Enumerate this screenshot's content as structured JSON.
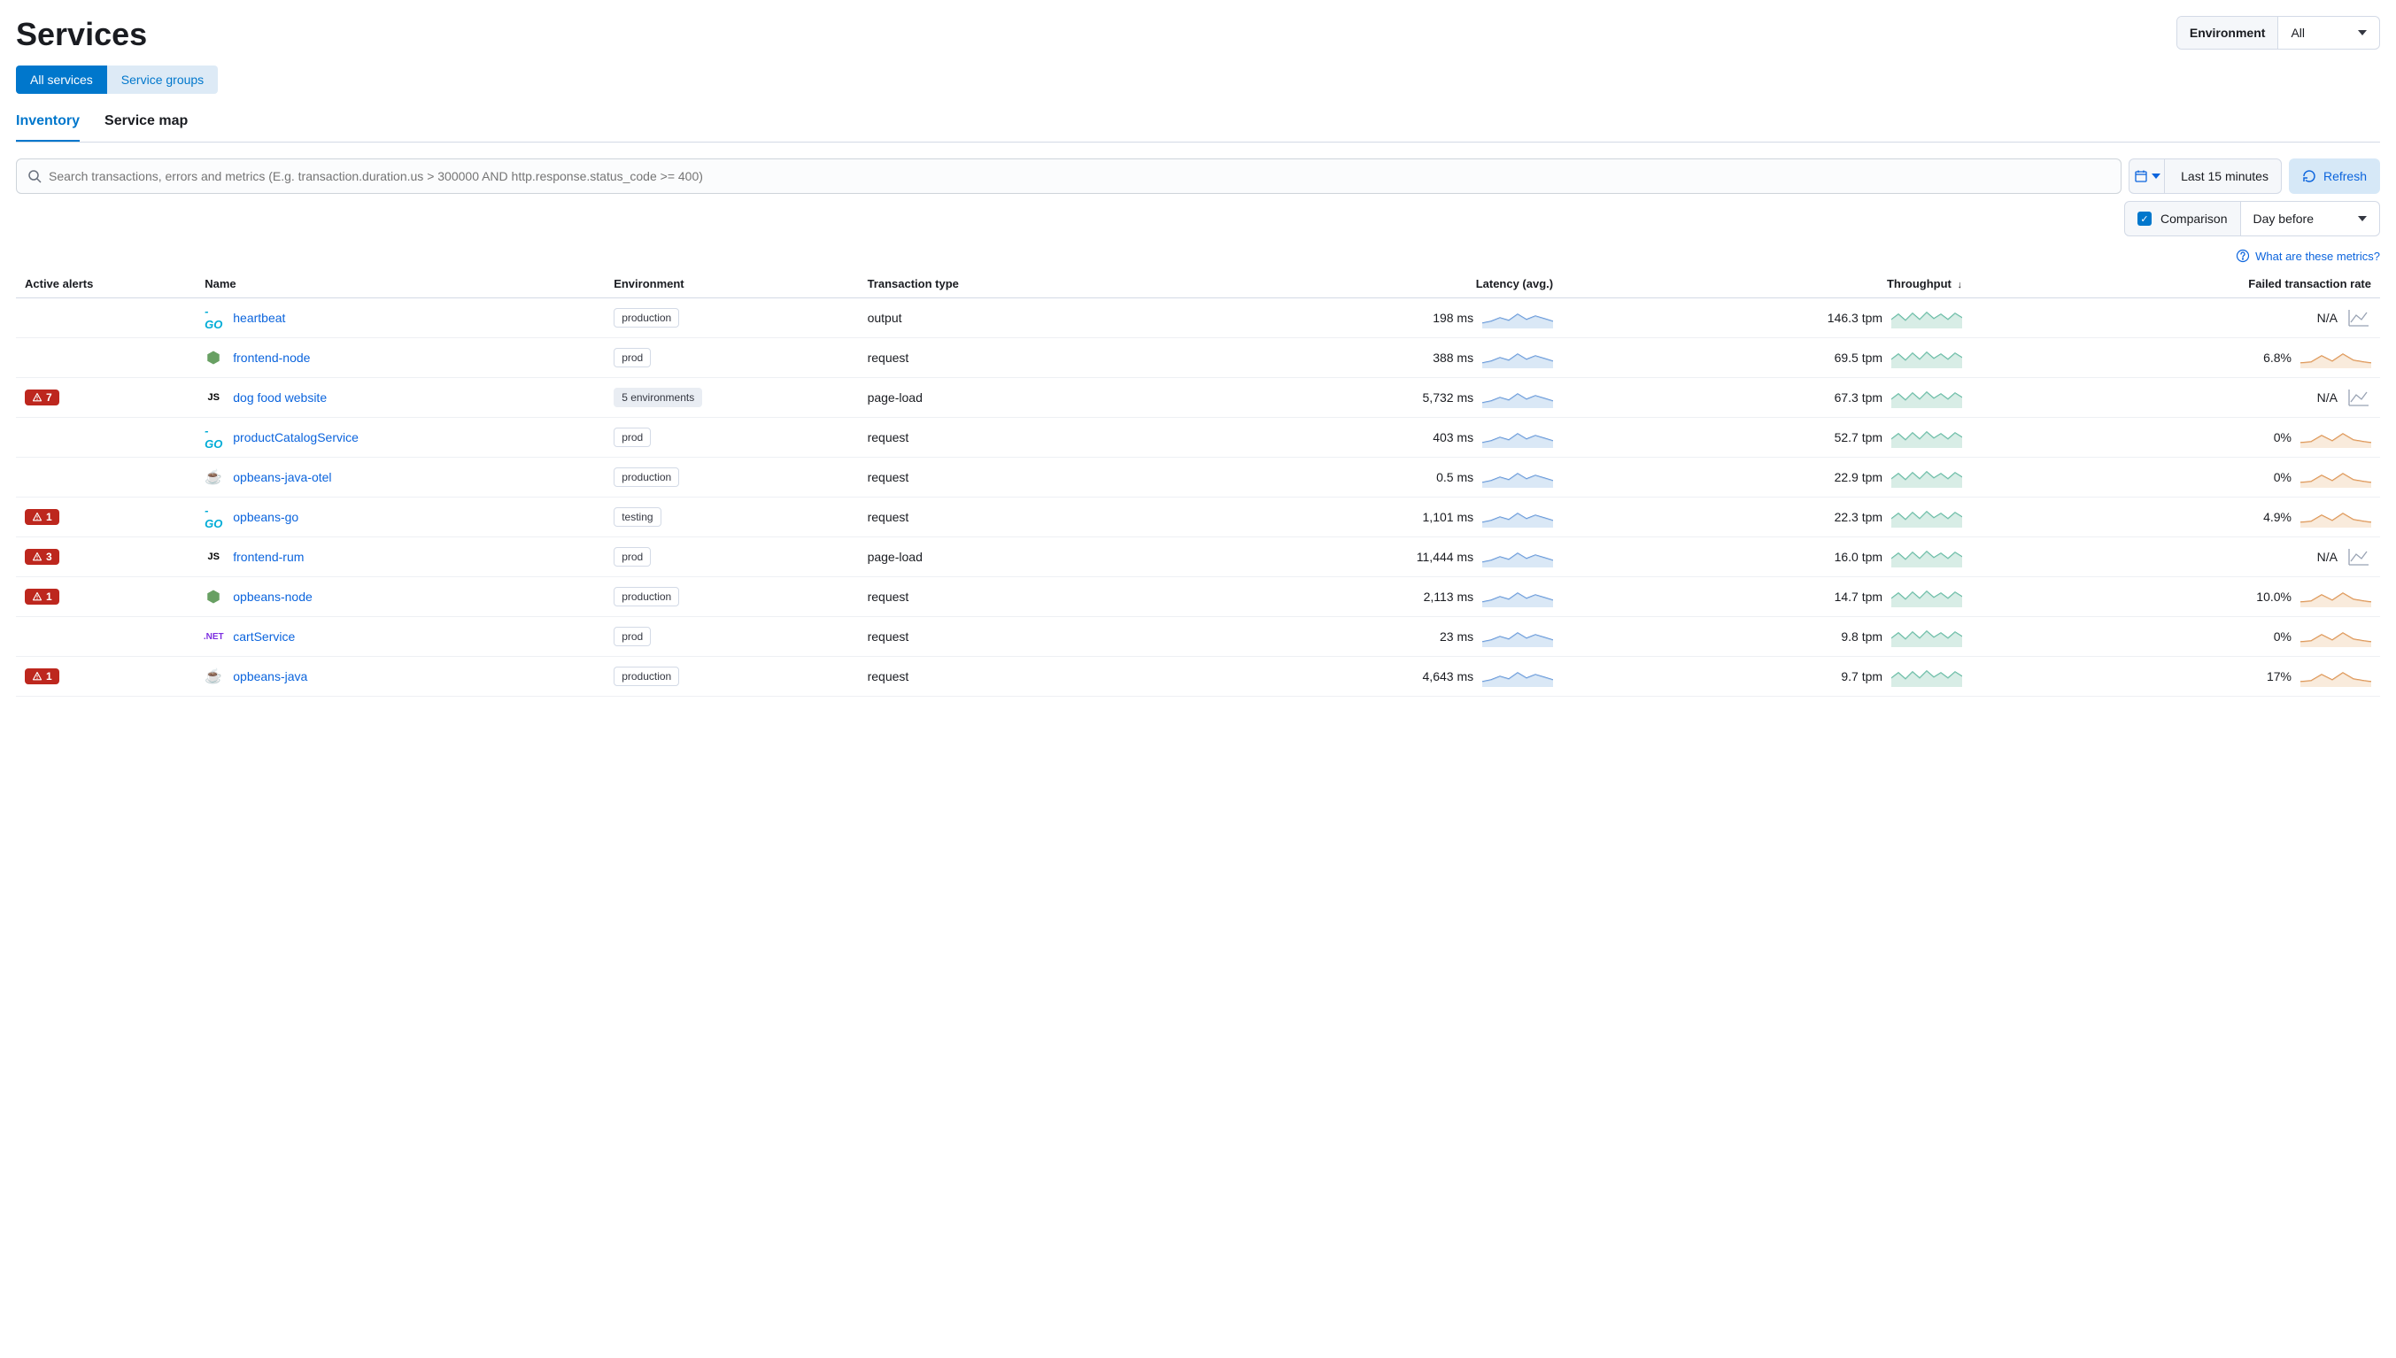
{
  "title": "Services",
  "env_picker": {
    "label": "Environment",
    "value": "All"
  },
  "tabs": {
    "all": "All services",
    "groups": "Service groups"
  },
  "subtabs": {
    "inventory": "Inventory",
    "map": "Service map"
  },
  "search": {
    "placeholder": "Search transactions, errors and metrics (E.g. transaction.duration.us > 300000 AND http.response.status_code >= 400)"
  },
  "time": {
    "range": "Last 15 minutes",
    "refresh": "Refresh"
  },
  "comparison": {
    "label": "Comparison",
    "value": "Day before"
  },
  "help": "What are these metrics?",
  "columns": {
    "alerts": "Active alerts",
    "name": "Name",
    "env": "Environment",
    "txn": "Transaction type",
    "latency": "Latency (avg.)",
    "throughput": "Throughput",
    "failrate": "Failed transaction rate"
  },
  "rows": [
    {
      "alerts": "",
      "lang": "go",
      "name": "heartbeat",
      "env": "production",
      "env_multi": false,
      "txn": "output",
      "latency": "198 ms",
      "throughput": "146.3 tpm",
      "failrate": "N/A",
      "fail_na": true
    },
    {
      "alerts": "",
      "lang": "node",
      "name": "frontend-node",
      "env": "prod",
      "env_multi": false,
      "txn": "request",
      "latency": "388 ms",
      "throughput": "69.5 tpm",
      "failrate": "6.8%",
      "fail_na": false
    },
    {
      "alerts": "7",
      "lang": "js",
      "name": "dog food website",
      "env": "5 environments",
      "env_multi": true,
      "txn": "page-load",
      "latency": "5,732 ms",
      "throughput": "67.3 tpm",
      "failrate": "N/A",
      "fail_na": true
    },
    {
      "alerts": "",
      "lang": "go",
      "name": "productCatalogService",
      "env": "prod",
      "env_multi": false,
      "txn": "request",
      "latency": "403 ms",
      "throughput": "52.7 tpm",
      "failrate": "0%",
      "fail_na": false
    },
    {
      "alerts": "",
      "lang": "java",
      "name": "opbeans-java-otel",
      "env": "production",
      "env_multi": false,
      "txn": "request",
      "latency": "0.5 ms",
      "throughput": "22.9 tpm",
      "failrate": "0%",
      "fail_na": false
    },
    {
      "alerts": "1",
      "lang": "go",
      "name": "opbeans-go",
      "env": "testing",
      "env_multi": false,
      "txn": "request",
      "latency": "1,101 ms",
      "throughput": "22.3 tpm",
      "failrate": "4.9%",
      "fail_na": false
    },
    {
      "alerts": "3",
      "lang": "js",
      "name": "frontend-rum",
      "env": "prod",
      "env_multi": false,
      "txn": "page-load",
      "latency": "11,444 ms",
      "throughput": "16.0 tpm",
      "failrate": "N/A",
      "fail_na": true
    },
    {
      "alerts": "1",
      "lang": "node",
      "name": "opbeans-node",
      "env": "production",
      "env_multi": false,
      "txn": "request",
      "latency": "2,113 ms",
      "throughput": "14.7 tpm",
      "failrate": "10.0%",
      "fail_na": false
    },
    {
      "alerts": "",
      "lang": "dotnet",
      "name": "cartService",
      "env": "prod",
      "env_multi": false,
      "txn": "request",
      "latency": "23 ms",
      "throughput": "9.8 tpm",
      "failrate": "0%",
      "fail_na": false
    },
    {
      "alerts": "1",
      "lang": "java",
      "name": "opbeans-java",
      "env": "production",
      "env_multi": false,
      "txn": "request",
      "latency": "4,643 ms",
      "throughput": "9.7 tpm",
      "failrate": "17%",
      "fail_na": false
    }
  ]
}
